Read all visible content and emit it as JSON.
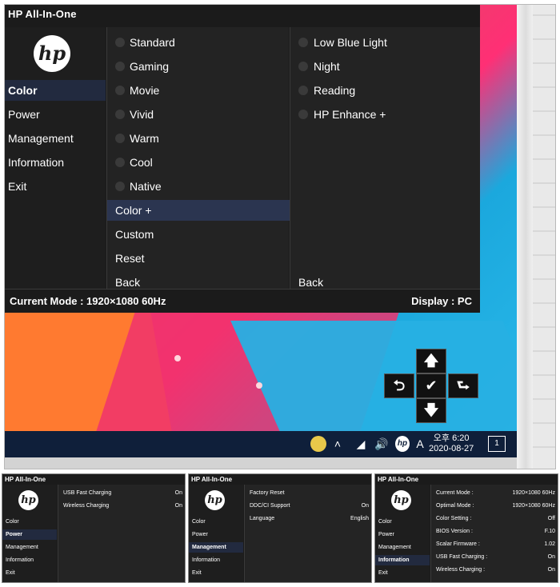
{
  "osd": {
    "title": "HP All-In-One",
    "logo_text": "hp",
    "menu": [
      "Color",
      "Power",
      "Management",
      "Information",
      "Exit"
    ],
    "active_menu": "Color",
    "color_options": [
      "Standard",
      "Gaming",
      "Movie",
      "Vivid",
      "Warm",
      "Cool",
      "Native",
      "Color +",
      "Custom",
      "Reset",
      "Back"
    ],
    "active_option": "Color +",
    "color_plus_options": [
      "Low Blue Light",
      "Night",
      "Reading",
      "HP Enhance +",
      "Back"
    ],
    "current_mode": "Current Mode : 1920×1080  60Hz",
    "display": "Display : PC"
  },
  "joystick": {
    "up": "🡅",
    "down": "🡇",
    "left": "⮌",
    "right": "⮑",
    "center": "✔"
  },
  "taskbar": {
    "ime": "A",
    "clock_time": "오후 6:20",
    "clock_date": "2020-08-27",
    "notification_count": "1"
  },
  "thumbnails": [
    {
      "title": "HP All-In-One",
      "logo_text": "hp",
      "menu": [
        "Color",
        "Power",
        "Management",
        "Information",
        "Exit"
      ],
      "active": "Power",
      "rows": [
        {
          "label": "USB Fast Charging",
          "value": "On"
        },
        {
          "label": "Wireless Charging",
          "value": "On"
        }
      ]
    },
    {
      "title": "HP All-In-One",
      "logo_text": "hp",
      "menu": [
        "Color",
        "Power",
        "Management",
        "Information",
        "Exit"
      ],
      "active": "Management",
      "rows": [
        {
          "label": "Factory Reset",
          "value": ""
        },
        {
          "label": "DDC/CI Support",
          "value": "On"
        },
        {
          "label": "Language",
          "value": "English"
        }
      ]
    },
    {
      "title": "HP All-In-One",
      "logo_text": "hp",
      "menu": [
        "Color",
        "Power",
        "Management",
        "Information",
        "Exit"
      ],
      "active": "Information",
      "rows": [
        {
          "label": "Current Mode :",
          "value": "1920×1080  60Hz"
        },
        {
          "label": "Optimal Mode :",
          "value": "1920×1080  60Hz"
        },
        {
          "label": "Color Setting :",
          "value": "Off"
        },
        {
          "label": "BIOS Version :",
          "value": "F.10"
        },
        {
          "label": "Scalar Firmware :",
          "value": "1.02"
        },
        {
          "label": "USB Fast Charging :",
          "value": "On"
        },
        {
          "label": "Wireless Charging :",
          "value": "On"
        }
      ]
    }
  ]
}
